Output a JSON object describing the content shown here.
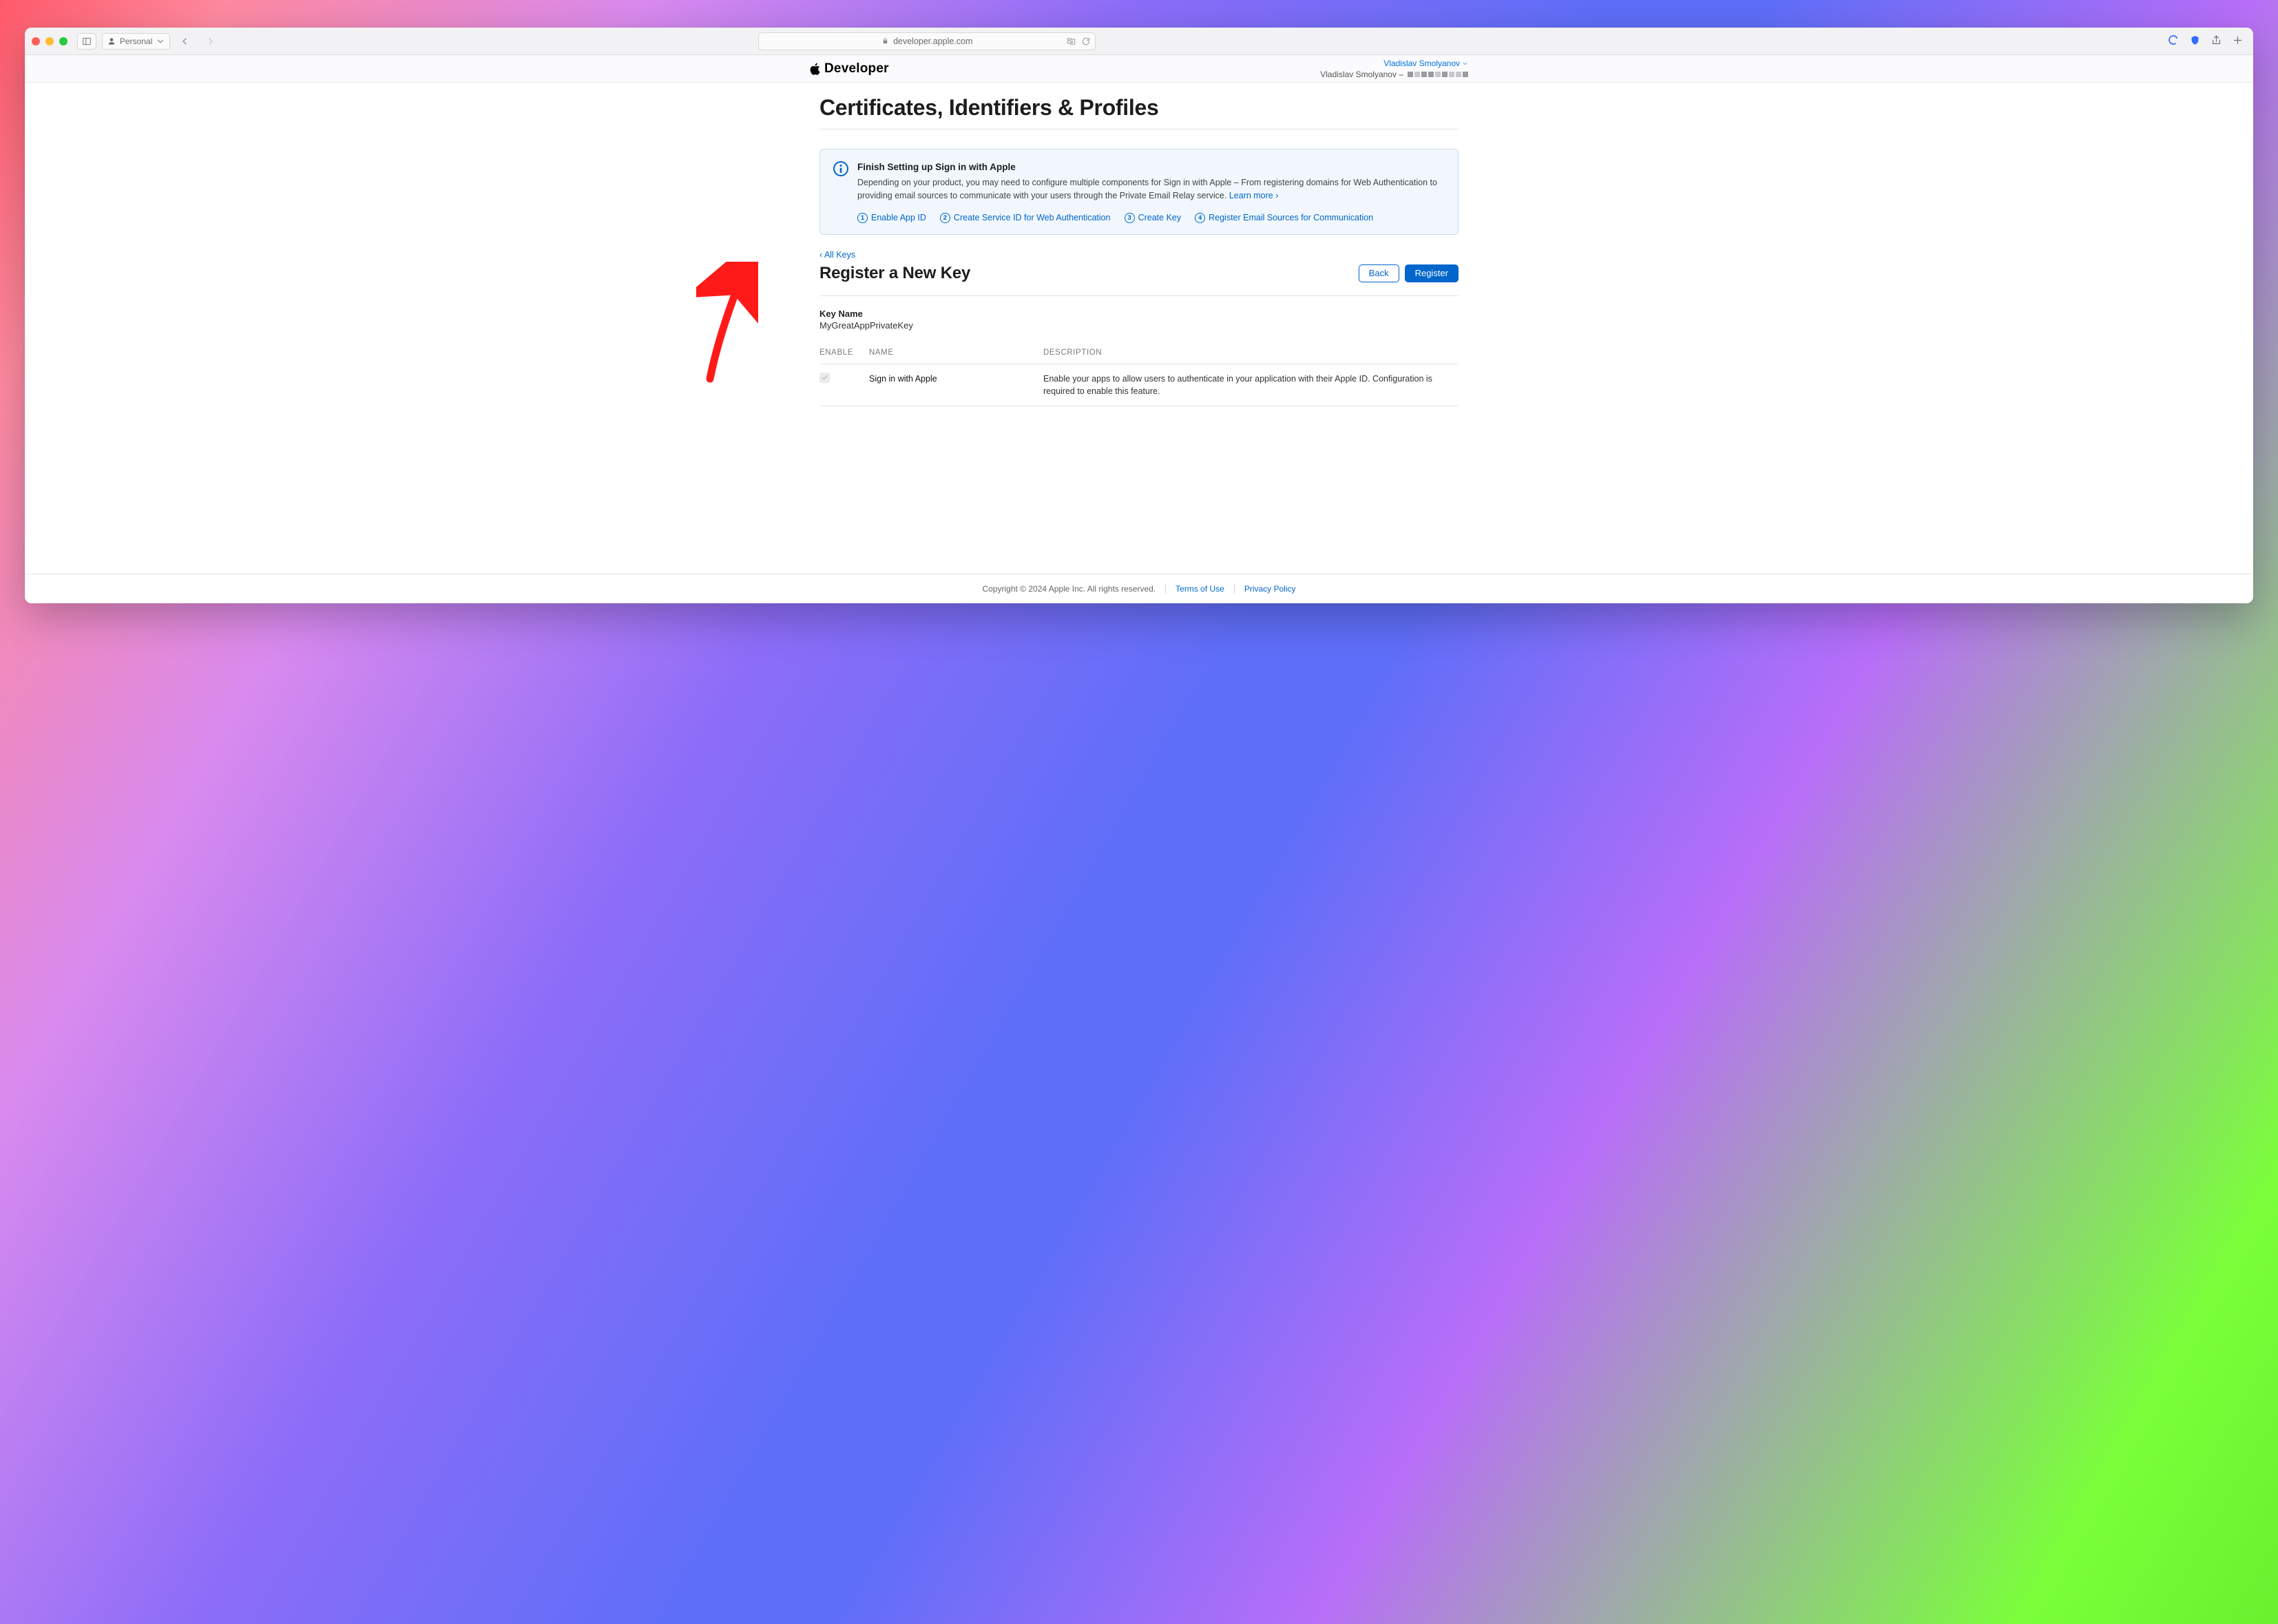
{
  "toolbar": {
    "profile_label": "Personal",
    "url_host": "developer.apple.com"
  },
  "nav": {
    "brand": "Developer",
    "account_name_link": "Vladislav Smolyanov",
    "account_name_plain": "Vladislav Smolyanov –"
  },
  "page": {
    "title": "Certificates, Identifiers & Profiles",
    "info": {
      "heading": "Finish Setting up Sign in with Apple",
      "body": "Depending on your product, you may need to configure multiple components for Sign in with Apple – From registering domains for Web Authentication to providing email sources to communicate with your users through the Private Email Relay service.",
      "learn_more": "Learn more ›",
      "steps": [
        "Enable App ID",
        "Create Service ID for Web Authentication",
        "Create Key",
        "Register Email Sources for Communication"
      ]
    },
    "back_link": "‹ All Keys",
    "subtitle": "Register a New Key",
    "buttons": {
      "back": "Back",
      "register": "Register"
    },
    "key_name_label": "Key Name",
    "key_name_value": "MyGreatAppPrivateKey",
    "columns": {
      "enable": "ENABLE",
      "name": "NAME",
      "description": "DESCRIPTION"
    },
    "row": {
      "name": "Sign in with Apple",
      "description": "Enable your apps to allow users to authenticate in your application with their Apple ID. Configuration is required to enable this feature."
    }
  },
  "footer": {
    "copyright": "Copyright © 2024 Apple Inc. All rights reserved.",
    "terms": "Terms of Use",
    "privacy": "Privacy Policy"
  }
}
